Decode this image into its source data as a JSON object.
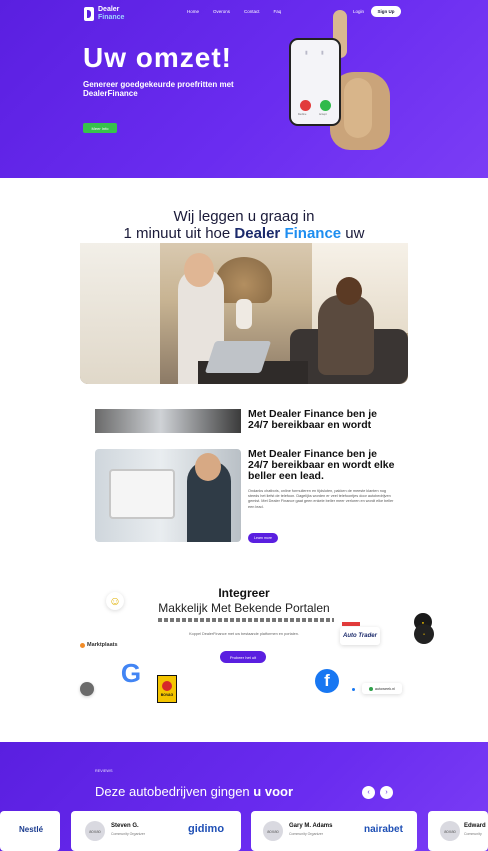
{
  "header": {
    "logo_line1": "Dealer",
    "logo_line2": "Finance",
    "nav": [
      "Home",
      "Overons",
      "Contact",
      "Faq"
    ],
    "login_label": "Login",
    "signup_label": "Sign Up"
  },
  "hero": {
    "title": "Uw omzet!",
    "subtitle": "Genereer goedgekeurde proefritten met DealerFinance",
    "cta_label": "Meer Info",
    "phone_label_decline": "Decline",
    "phone_label_accept": "Accept"
  },
  "intro": {
    "line1": "Wij leggen u graag in",
    "line2_pre": "1 minuut uit hoe ",
    "line2_brand1": "Dealer",
    "line2_brand2": " Finance",
    "line2_post": " uw"
  },
  "feature": {
    "title1": "Met Dealer Finance ben je 24/7 bereikbaar en wordt",
    "title2": "Met Dealer Finance ben je 24/7 bereikbaar en wordt elke beller een lead.",
    "body": "Ondanks chatbots, online formulieren en tijdsloten, pakken de meeste klanten nog steeds het liefst de telefoon. Dagelijks worden er veel telefoontjes door autobedrijven gemist. Met Dealer Finance gaat geen enkele beller meer verloren en wordt elke beller een lead.",
    "button_label": "Learn more"
  },
  "integration": {
    "title": "Integreer",
    "subtitle": "Makkelijk Met Bekende Portalen",
    "text": "Koppel DealerFinance met uw bestaande platformen en portalen.",
    "button_label": "Probeer het uit",
    "logo_marktplaats": "Marktplaats",
    "logo_google": "G",
    "logo_bovag": "BOVAG",
    "logo_autotrader": "Auto Trader",
    "logo_facebook": "f",
    "logo_autoweek": "autoweek.nl"
  },
  "testimonials": {
    "tag": "REVIEWS",
    "title_pre": "Deze autobedrijven gingen ",
    "title_bold": "u voor",
    "prev_icon": "arrow-left-icon",
    "next_icon": "arrow-right-icon",
    "cards": [
      {
        "brand": "Nestlé"
      },
      {
        "avatar": "80X80",
        "name": "Steven G.",
        "role": "Community Organizer",
        "brand": "gidimo"
      },
      {
        "avatar": "80X80",
        "name": "Gary M. Adams",
        "role": "Community Organizer",
        "brand": "nairabet"
      },
      {
        "avatar": "80X80",
        "name": "Edward",
        "role": "Community"
      }
    ]
  },
  "colors": {
    "primary": "#5a1fe0",
    "green": "#37c24b",
    "brand_blue": "#1e8ef0"
  }
}
